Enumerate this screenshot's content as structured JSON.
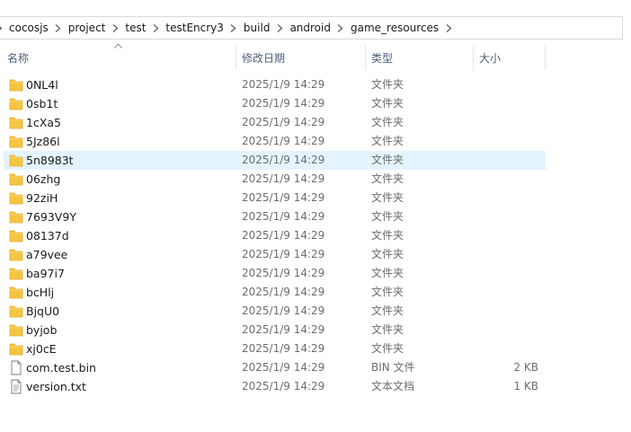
{
  "breadcrumb": {
    "segments": [
      "cocosjs",
      "project",
      "test",
      "testEncry3",
      "build",
      "android",
      "game_resources"
    ]
  },
  "columns": {
    "name": "名称",
    "date": "修改日期",
    "type": "类型",
    "size": "大小"
  },
  "files": [
    {
      "name": "0NL4l",
      "date": "2025/1/9 14:29",
      "type": "文件夹",
      "size": "",
      "icon": "folder-icon"
    },
    {
      "name": "0sb1t",
      "date": "2025/1/9 14:29",
      "type": "文件夹",
      "size": "",
      "icon": "folder-icon"
    },
    {
      "name": "1cXa5",
      "date": "2025/1/9 14:29",
      "type": "文件夹",
      "size": "",
      "icon": "folder-icon"
    },
    {
      "name": "5Jz86l",
      "date": "2025/1/9 14:29",
      "type": "文件夹",
      "size": "",
      "icon": "folder-icon"
    },
    {
      "name": "5n8983t",
      "date": "2025/1/9 14:29",
      "type": "文件夹",
      "size": "",
      "icon": "folder-icon",
      "selected": true
    },
    {
      "name": "06zhg",
      "date": "2025/1/9 14:29",
      "type": "文件夹",
      "size": "",
      "icon": "folder-icon"
    },
    {
      "name": "92ziH",
      "date": "2025/1/9 14:29",
      "type": "文件夹",
      "size": "",
      "icon": "folder-icon"
    },
    {
      "name": "7693V9Y",
      "date": "2025/1/9 14:29",
      "type": "文件夹",
      "size": "",
      "icon": "folder-icon"
    },
    {
      "name": "08137d",
      "date": "2025/1/9 14:29",
      "type": "文件夹",
      "size": "",
      "icon": "folder-icon"
    },
    {
      "name": "a79vee",
      "date": "2025/1/9 14:29",
      "type": "文件夹",
      "size": "",
      "icon": "folder-icon"
    },
    {
      "name": "ba97i7",
      "date": "2025/1/9 14:29",
      "type": "文件夹",
      "size": "",
      "icon": "folder-icon"
    },
    {
      "name": "bcHlj",
      "date": "2025/1/9 14:29",
      "type": "文件夹",
      "size": "",
      "icon": "folder-icon"
    },
    {
      "name": "BjqU0",
      "date": "2025/1/9 14:29",
      "type": "文件夹",
      "size": "",
      "icon": "folder-icon"
    },
    {
      "name": "byjob",
      "date": "2025/1/9 14:29",
      "type": "文件夹",
      "size": "",
      "icon": "folder-icon"
    },
    {
      "name": "xj0cE",
      "date": "2025/1/9 14:29",
      "type": "文件夹",
      "size": "",
      "icon": "folder-icon"
    },
    {
      "name": "com.test.bin",
      "date": "2025/1/9 14:29",
      "type": "BIN 文件",
      "size": "2 KB",
      "icon": "file-icon"
    },
    {
      "name": "version.txt",
      "date": "2025/1/9 14:29",
      "type": "文本文档",
      "size": "1 KB",
      "icon": "text-file-icon"
    }
  ],
  "colors": {
    "folder": "#f5c542",
    "folder_dark": "#e3ac28",
    "selected_row": "#e5f3ff",
    "header_text": "#4c607a"
  }
}
